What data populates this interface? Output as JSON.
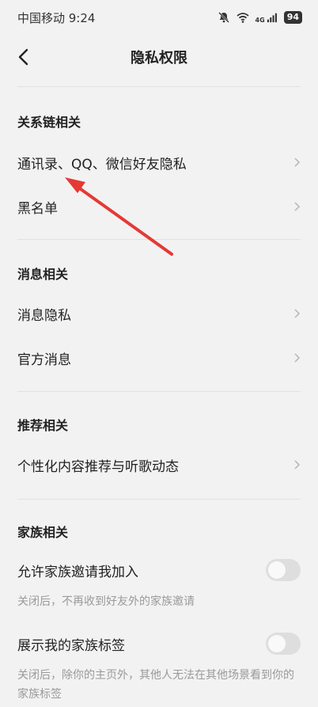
{
  "status": {
    "carrier_time": "中国移动 9:24",
    "network": "4G",
    "battery": "94"
  },
  "nav": {
    "title": "隐私权限"
  },
  "sections": {
    "relations": {
      "header": "关系链相关",
      "items": [
        "通讯录、QQ、微信好友隐私",
        "黑名单"
      ]
    },
    "messages": {
      "header": "消息相关",
      "items": [
        "消息隐私",
        "官方消息"
      ]
    },
    "recommend": {
      "header": "推荐相关",
      "items": [
        "个性化内容推荐与听歌动态"
      ]
    },
    "family": {
      "header": "家族相关",
      "toggles": [
        {
          "label": "允许家族邀请我加入",
          "on": false,
          "desc": "关闭后，不再收到好友外的家族邀请"
        },
        {
          "label": "展示我的家族标签",
          "on": false,
          "desc": "关闭后，除你的主页外，其他人无法在其他场景看到你的家族标签"
        }
      ]
    }
  },
  "colors": {
    "background": "#f2f2f2",
    "annotation_arrow": "#e53935",
    "toggle_off": "#dedede"
  }
}
